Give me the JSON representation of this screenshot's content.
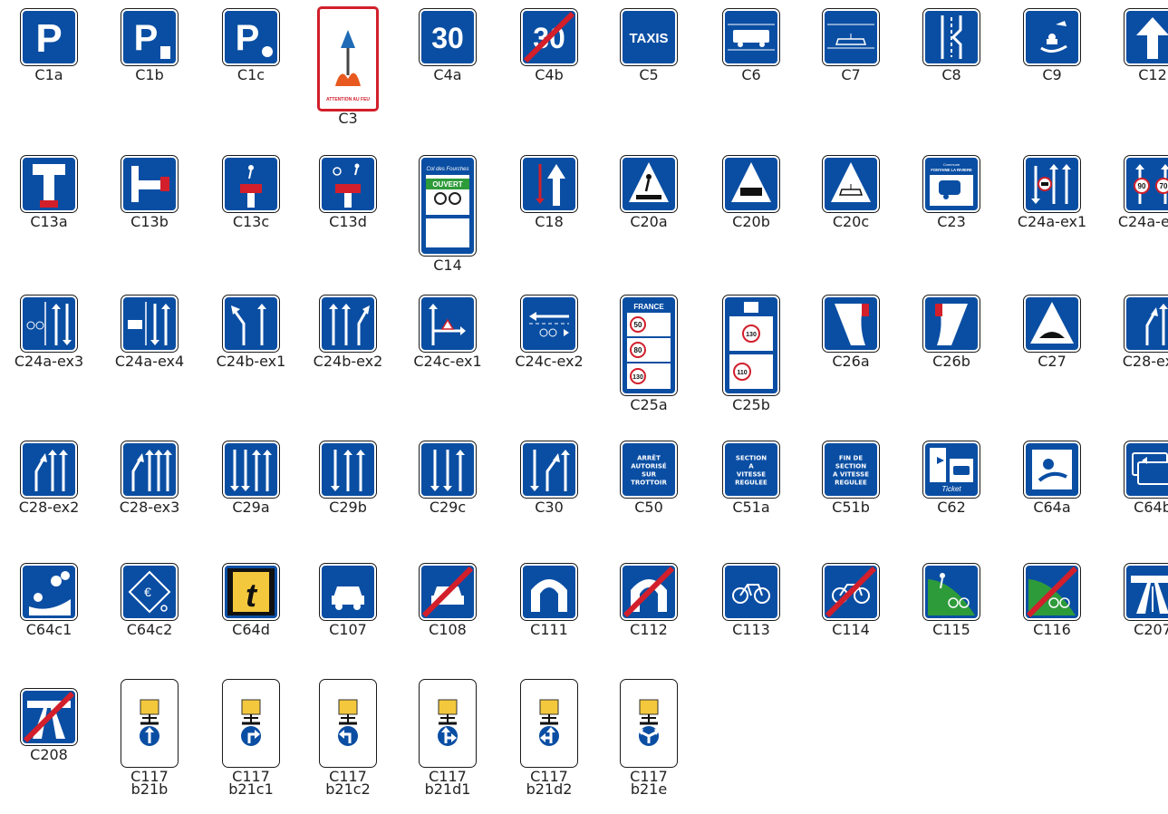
{
  "signs": [
    {
      "code": "C1a",
      "label": "C1a",
      "icon": "parking-icon",
      "text": "P"
    },
    {
      "code": "C1b",
      "label": "C1b",
      "icon": "parking-disc-icon",
      "text": "P"
    },
    {
      "code": "C1c",
      "label": "C1c",
      "icon": "parking-meter-icon",
      "text": "P"
    },
    {
      "code": "C3",
      "label": "C3",
      "icon": "fire-warning-icon",
      "text": "ATTENTION AU FEU"
    },
    {
      "code": "C4a",
      "label": "C4a",
      "icon": "speed-recommended-icon",
      "text": "30"
    },
    {
      "code": "C4b",
      "label": "C4b",
      "icon": "end-speed-recommended-icon",
      "text": "30"
    },
    {
      "code": "C5",
      "label": "C5",
      "icon": "taxi-icon",
      "text": "TAXIS"
    },
    {
      "code": "C6",
      "label": "C6",
      "icon": "bus-icon"
    },
    {
      "code": "C7",
      "label": "C7",
      "icon": "tram-icon"
    },
    {
      "code": "C8",
      "label": "C8",
      "icon": "lay-by-icon"
    },
    {
      "code": "C9",
      "label": "C9",
      "icon": "toll-icon"
    },
    {
      "code": "C12",
      "label": "C12",
      "icon": "one-way-icon"
    },
    {
      "code": "C13a",
      "label": "C13a",
      "icon": "dead-end-icon"
    },
    {
      "code": "C13b",
      "label": "C13b",
      "icon": "dead-end-side-icon"
    },
    {
      "code": "C13c",
      "label": "C13c",
      "icon": "dead-end-pedestrian-icon"
    },
    {
      "code": "C13d",
      "label": "C13d",
      "icon": "dead-end-bike-pedestrian-icon"
    },
    {
      "code": "C14",
      "label": "C14",
      "icon": "pass-status-icon",
      "text": "Col des Fourches",
      "text2": "OUVERT"
    },
    {
      "code": "C18",
      "label": "C18",
      "icon": "priority-over-oncoming-icon"
    },
    {
      "code": "C20a",
      "label": "C20a",
      "icon": "pedestrian-crossing-icon"
    },
    {
      "code": "C20b",
      "label": "C20b",
      "icon": "bus-crossing-icon"
    },
    {
      "code": "C20c",
      "label": "C20c",
      "icon": "tram-crossing-icon"
    },
    {
      "code": "C23",
      "label": "C23",
      "icon": "camping-car-icon",
      "text": "Commune",
      "text2": "FONTAINE LA RIVIERE"
    },
    {
      "code": "C24a-ex1",
      "label": "C24a-ex1",
      "icon": "lane-restriction-icon"
    },
    {
      "code": "C24a-ex2",
      "label": "C24a-ex2",
      "icon": "lane-speed-icon",
      "text": "90",
      "text2": "70"
    },
    {
      "code": "C24a-ex3",
      "label": "C24a-ex3",
      "icon": "bike-lane-icon"
    },
    {
      "code": "C24a-ex4",
      "label": "C24a-ex4",
      "icon": "bus-lane-icon"
    },
    {
      "code": "C24b-ex1",
      "label": "C24b-ex1",
      "icon": "lane-direction-icon"
    },
    {
      "code": "C24b-ex2",
      "label": "C24b-ex2",
      "icon": "lane-direction-3-icon"
    },
    {
      "code": "C24c-ex1",
      "label": "C24c-ex1",
      "icon": "right-turn-lane-icon"
    },
    {
      "code": "C24c-ex2",
      "label": "C24c-ex2",
      "icon": "bike-contraflow-icon"
    },
    {
      "code": "C25a",
      "label": "C25a",
      "icon": "national-speed-limits-icon",
      "text": "FRANCE",
      "values": [
        "50",
        "80",
        "130"
      ]
    },
    {
      "code": "C25b",
      "label": "C25b",
      "icon": "motorway-speed-limits-icon",
      "values": [
        "130",
        "110"
      ]
    },
    {
      "code": "C26a",
      "label": "C26a",
      "icon": "emergency-lane-icon"
    },
    {
      "code": "C26b",
      "label": "C26b",
      "icon": "emergency-lane-left-icon"
    },
    {
      "code": "C27",
      "label": "C27",
      "icon": "speed-bump-icon"
    },
    {
      "code": "C28-ex1",
      "label": "C28-ex1",
      "icon": "lane-added-icon"
    },
    {
      "code": "C28-ex2",
      "label": "C28-ex2",
      "icon": "lane-added-2-icon"
    },
    {
      "code": "C28-ex3",
      "label": "C28-ex3",
      "icon": "lane-added-3-icon"
    },
    {
      "code": "C29a",
      "label": "C29a",
      "icon": "lane-config-a-icon"
    },
    {
      "code": "C29b",
      "label": "C29b",
      "icon": "lane-config-b-icon"
    },
    {
      "code": "C29c",
      "label": "C29c",
      "icon": "lane-config-c-icon"
    },
    {
      "code": "C30",
      "label": "C30",
      "icon": "lane-merge-icon"
    },
    {
      "code": "C50",
      "label": "C50",
      "icon": "text-sign-icon",
      "text": "ARRÊT AUTORISÉ SUR TROTTOIR"
    },
    {
      "code": "C51a",
      "label": "C51a",
      "icon": "text-sign-icon",
      "text": "SECTION A VITESSE REGULEE"
    },
    {
      "code": "C51b",
      "label": "C51b",
      "icon": "text-sign-icon",
      "text": "FIN DE SECTION A VITESSE REGULEE"
    },
    {
      "code": "C62",
      "label": "C62",
      "icon": "ticket-icon",
      "text": "Ticket"
    },
    {
      "code": "C64a",
      "label": "C64a",
      "icon": "toll-attendant-icon"
    },
    {
      "code": "C64b",
      "label": "C64b",
      "icon": "toll-card-icon"
    },
    {
      "code": "C64c1",
      "label": "C64c1",
      "icon": "toll-coins-icon"
    },
    {
      "code": "C64c2",
      "label": "C64c2",
      "icon": "toll-telepeage-icon"
    },
    {
      "code": "C64d",
      "label": "C64d",
      "icon": "toll-t-icon",
      "text": "t"
    },
    {
      "code": "C107",
      "label": "C107",
      "icon": "car-road-icon"
    },
    {
      "code": "C108",
      "label": "C108",
      "icon": "end-car-road-icon"
    },
    {
      "code": "C111",
      "label": "C111",
      "icon": "tunnel-icon"
    },
    {
      "code": "C112",
      "label": "C112",
      "icon": "end-tunnel-icon"
    },
    {
      "code": "C113",
      "label": "C113",
      "icon": "bike-path-icon"
    },
    {
      "code": "C114",
      "label": "C114",
      "icon": "end-bike-path-icon"
    },
    {
      "code": "C115",
      "label": "C115",
      "icon": "greenway-icon"
    },
    {
      "code": "C116",
      "label": "C116",
      "icon": "end-greenway-icon"
    },
    {
      "code": "C207",
      "label": "C207",
      "icon": "motorway-icon"
    },
    {
      "code": "C208",
      "label": "C208",
      "icon": "end-motorway-icon"
    },
    {
      "code": "C117 b21b",
      "label": "C117\nb21b",
      "icon": "hazmat-straight-icon"
    },
    {
      "code": "C117 b21c1",
      "label": "C117\nb21c1",
      "icon": "hazmat-right-icon"
    },
    {
      "code": "C117 b21c2",
      "label": "C117\nb21c2",
      "icon": "hazmat-left-icon"
    },
    {
      "code": "C117 b21d1",
      "label": "C117\nb21d1",
      "icon": "hazmat-straight-right-icon"
    },
    {
      "code": "C117 b21d2",
      "label": "C117\nb21d2",
      "icon": "hazmat-straight-left-icon"
    },
    {
      "code": "C117 b21e",
      "label": "C117\nb21e",
      "icon": "hazmat-left-right-icon"
    }
  ],
  "colors": {
    "sign_blue": "#0a4ea3",
    "red": "#d21f2b",
    "green": "#2e9b3a",
    "yellow": "#f3c83c"
  }
}
